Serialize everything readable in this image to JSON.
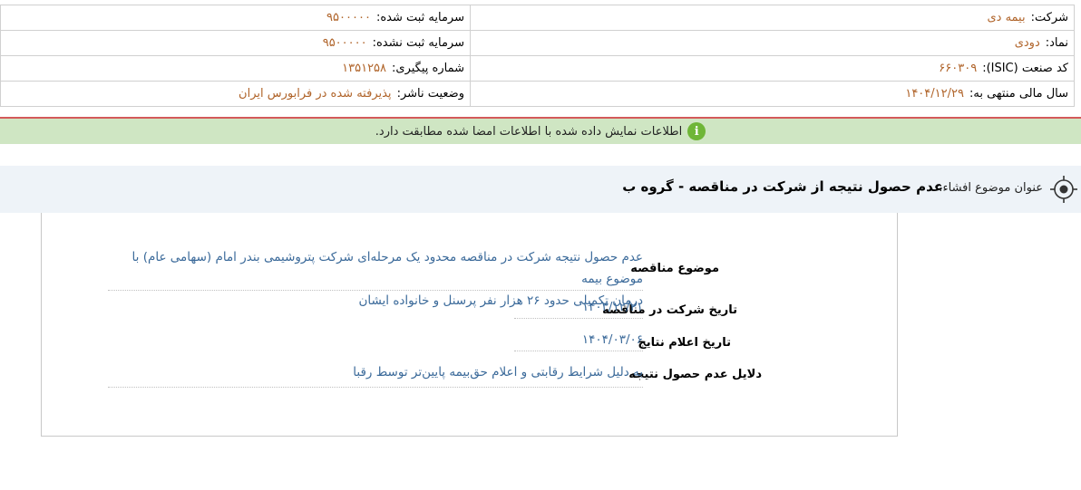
{
  "header": {
    "company_label": "شرکت:",
    "company_value": "بیمه دی",
    "registered_capital_label": "سرمایه ثبت شده:",
    "registered_capital_value": "۹۵۰۰۰۰۰",
    "symbol_label": "نماد:",
    "symbol_value": "دودی",
    "unregistered_capital_label": "سرمایه ثبت نشده:",
    "unregistered_capital_value": "۹۵۰۰۰۰۰",
    "isic_label": "کد صنعت (ISIC):",
    "isic_value": "۶۶۰۳۰۹",
    "tracking_label": "شماره پیگیری:",
    "tracking_value": "۱۳۵۱۲۵۸",
    "fiscal_year_label": "سال مالی منتهی به:",
    "fiscal_year_value": "۱۴۰۴/۱۲/۲۹",
    "publisher_status_label": "وضعیت ناشر:",
    "publisher_status_value": "پذیرفته شده در فرابورس ایران"
  },
  "notice": {
    "icon": "info-icon",
    "text": "اطلاعات نمایش داده شده با اطلاعات امضا شده مطابقت دارد."
  },
  "disclosure": {
    "icon": "target-icon",
    "title_label": "عنوان موضوع افشاء:",
    "title": "عدم حصول نتیجه از شرکت در مناقصه - گروه ب"
  },
  "fields": {
    "subject_label": "موضوع مناقصه",
    "subject_line1": "عدم حصول نتیجه شرکت در مناقصه محدود یک مرحله‌ای شرکت پتروشیمی بندر امام (سهامی عام) با موضوع بیمه",
    "subject_line2": "درمان تکمیلی حدود ۲۶ هزار نفر پرسنل و خانواده ایشان",
    "participation_date_label": "تاریخ شرکت در مناقصه",
    "participation_date": "۱۴۰۳/۱۲/۲۱",
    "results_date_label": "تاریخ اعلام نتایج",
    "results_date": "۱۴۰۴/۰۳/۰۶",
    "reasons_label": "دلایل عدم حصول نتیجه",
    "reasons": "به دلیل شرایط رقابتی و اعلام حق‌بیمه پایین‌تر توسط رقبا"
  },
  "colors": {
    "value_orange": "#b0642a",
    "value_blue": "#3b6a9a",
    "notice_bg": "#cfe6c3",
    "notice_border": "#d45a5a",
    "info_icon": "#6fb637",
    "title_bar_bg": "#eef3f8"
  }
}
